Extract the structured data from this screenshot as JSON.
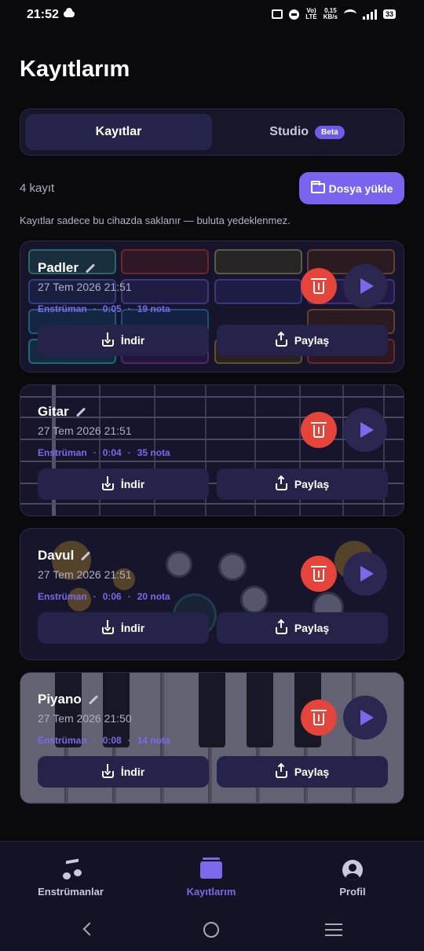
{
  "status_bar": {
    "time": "21:52",
    "net_label_1": "Vo)",
    "net_label_2": "LTE",
    "speed_value": "0,15",
    "speed_unit": "KB/s",
    "battery": "33"
  },
  "page_title": "Kayıtlarım",
  "tabs": [
    {
      "label": "Kayıtlar",
      "active": true
    },
    {
      "label": "Studio",
      "badge": "Beta",
      "active": false
    }
  ],
  "recording_count": "4 kayıt",
  "upload_button": "Dosya yükle",
  "local_note": "Kayıtlar sadece bu cihazda saklanır — buluta yedeklenmez.",
  "recordings": [
    {
      "name": "Padler",
      "date": "27 Tem 2026 21:51",
      "type": "Enstrüman",
      "duration": "0:05",
      "notes": "19 nota",
      "download": "İndir",
      "share": "Paylaş",
      "background": "pads"
    },
    {
      "name": "Gitar",
      "date": "27 Tem 2026 21:51",
      "type": "Enstrüman",
      "duration": "0:04",
      "notes": "35 nota",
      "download": "İndir",
      "share": "Paylaş",
      "background": "guitar"
    },
    {
      "name": "Davul",
      "date": "27 Tem 2026 21:51",
      "type": "Enstrüman",
      "duration": "0:06",
      "notes": "20 nota",
      "download": "İndir",
      "share": "Paylaş",
      "background": "drums"
    },
    {
      "name": "Piyano",
      "date": "27 Tem 2026 21:50",
      "type": "Enstrüman",
      "duration": "0:08",
      "notes": "14 nota",
      "download": "İndir",
      "share": "Paylaş",
      "background": "piano"
    }
  ],
  "bottom_nav": [
    {
      "label": "Enstrümanlar",
      "icon": "music-note-icon",
      "active": false
    },
    {
      "label": "Kayıtlarım",
      "icon": "recordings-stack-icon",
      "active": true
    },
    {
      "label": "Profil",
      "icon": "profile-icon",
      "active": false
    }
  ],
  "colors": {
    "accent": "#7b69ec",
    "delete": "#e5443a",
    "background": "#0a0a0c",
    "card": "#16152b"
  }
}
